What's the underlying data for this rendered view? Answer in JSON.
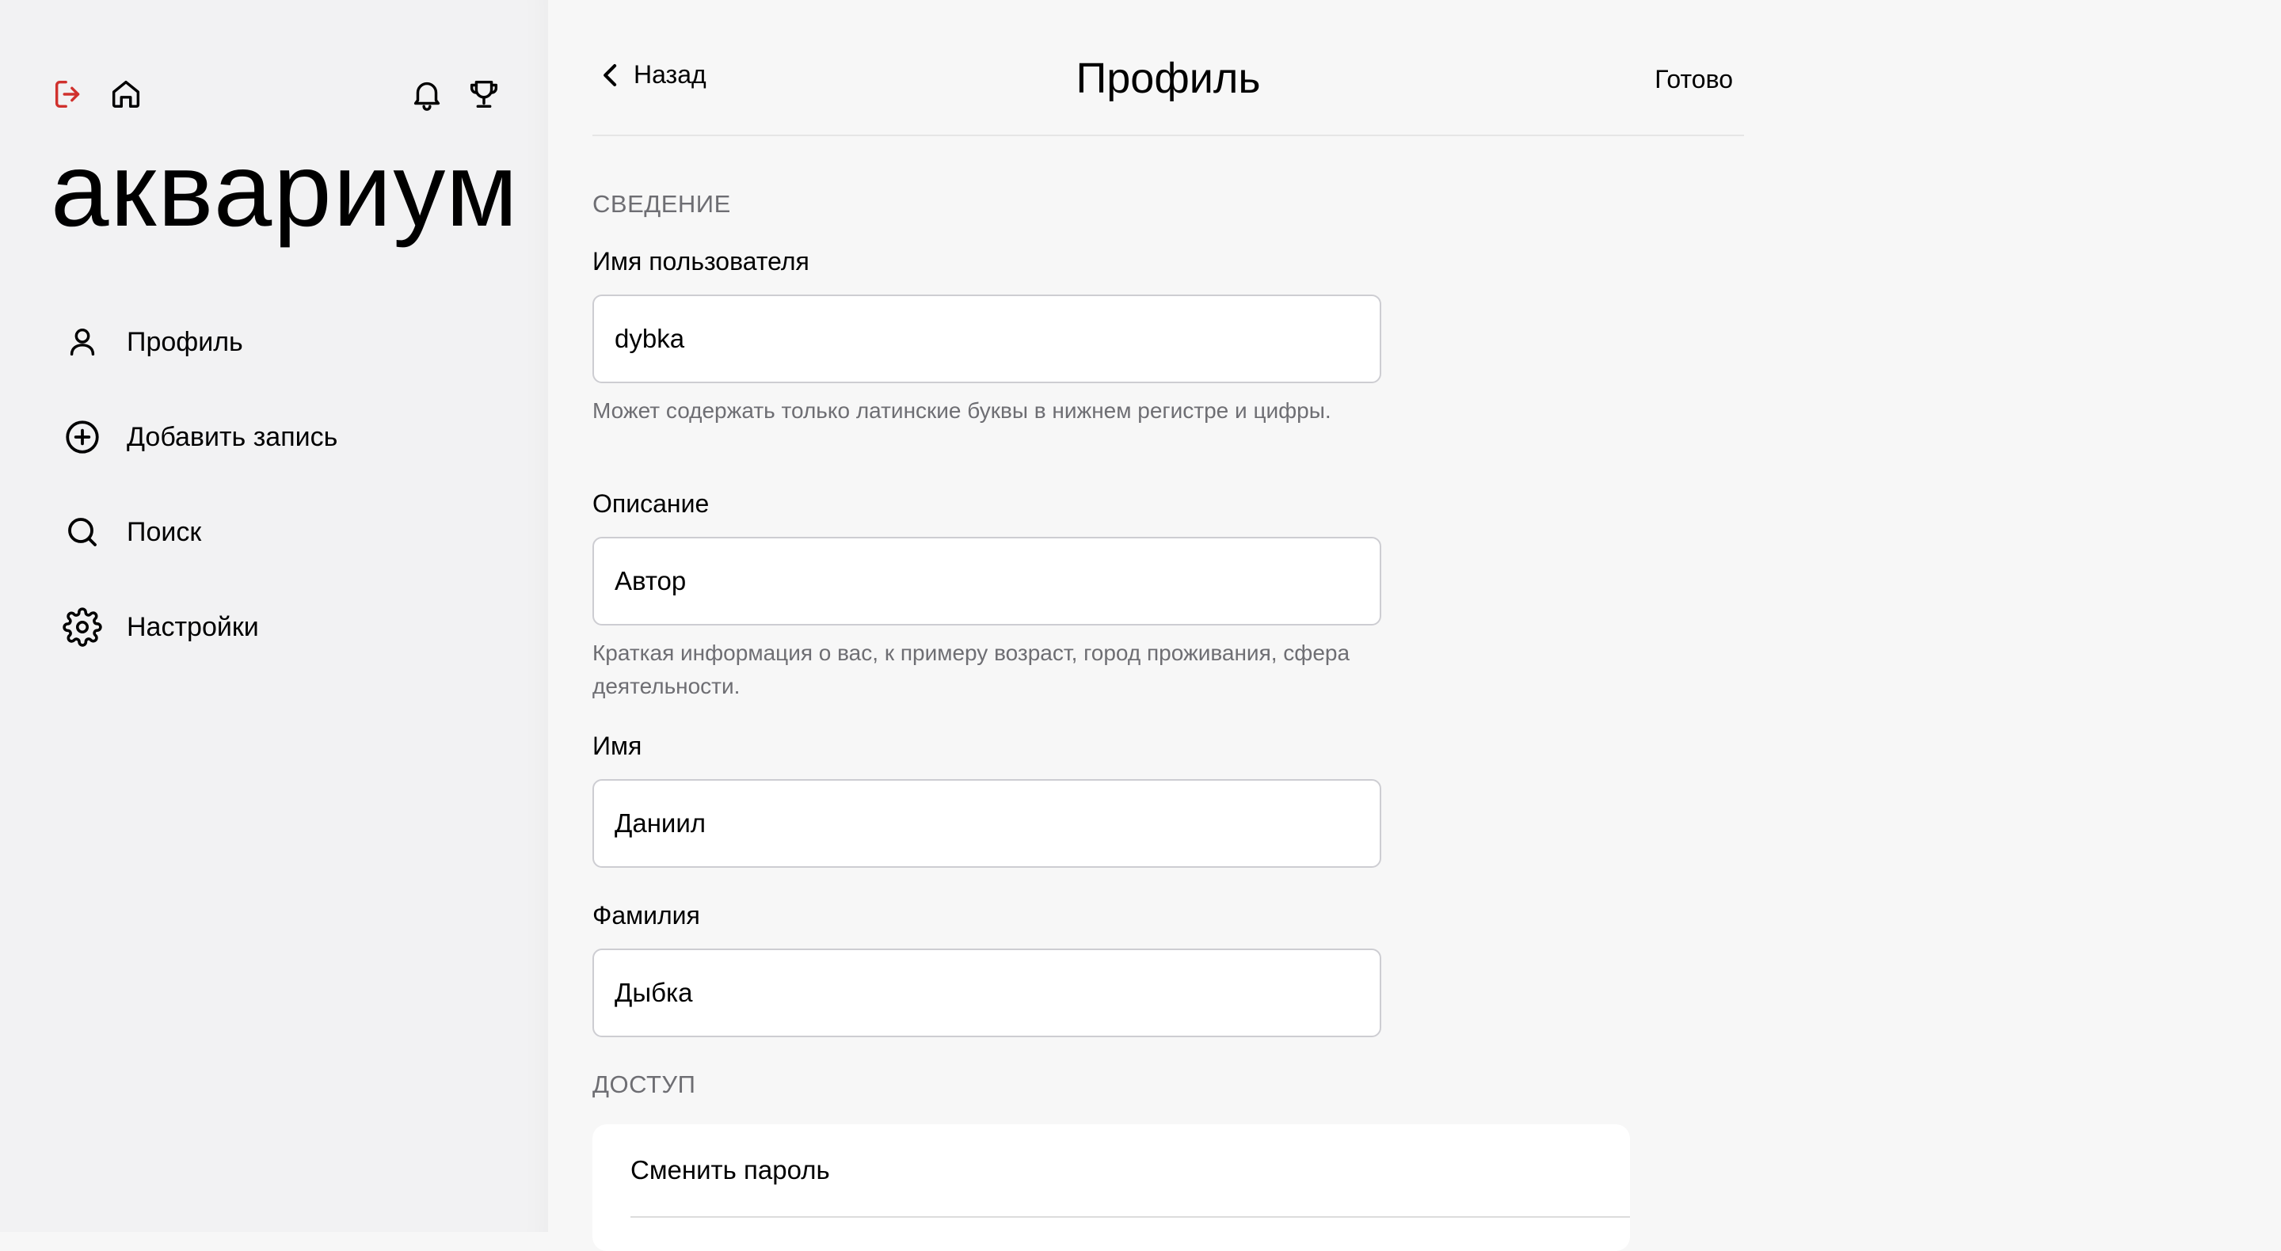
{
  "sidebar": {
    "logo": "аквариум",
    "items": [
      {
        "label": "Профиль",
        "icon": "user-icon"
      },
      {
        "label": "Добавить запись",
        "icon": "plus-circle-icon"
      },
      {
        "label": "Поиск",
        "icon": "search-icon"
      },
      {
        "label": "Настройки",
        "icon": "gear-icon"
      }
    ],
    "top_icons": [
      "logout-icon",
      "home-icon",
      "bell-icon",
      "trophy-icon"
    ]
  },
  "header": {
    "back_label": "Назад",
    "title": "Профиль",
    "done_label": "Готово"
  },
  "sections": {
    "info_title": "СВЕДЕНИЕ",
    "access_title": "ДОСТУП"
  },
  "fields": {
    "username": {
      "label": "Имя пользователя",
      "value": "dybka",
      "hint": "Может содержать только латинские буквы в нижнем регистре и цифры."
    },
    "description": {
      "label": "Описание",
      "value": "Автор",
      "hint": "Краткая информация о вас, к примеру возраст, город проживания, сфера деятельности."
    },
    "first_name": {
      "label": "Имя",
      "value": "Даниил"
    },
    "last_name": {
      "label": "Фамилия",
      "value": "Дыбка"
    }
  },
  "access": {
    "change_password_label": "Сменить пароль"
  },
  "colors": {
    "logout_accent": "#d0312d",
    "sidebar_bg": "#f2f2f3",
    "main_bg": "#f7f7f7"
  }
}
